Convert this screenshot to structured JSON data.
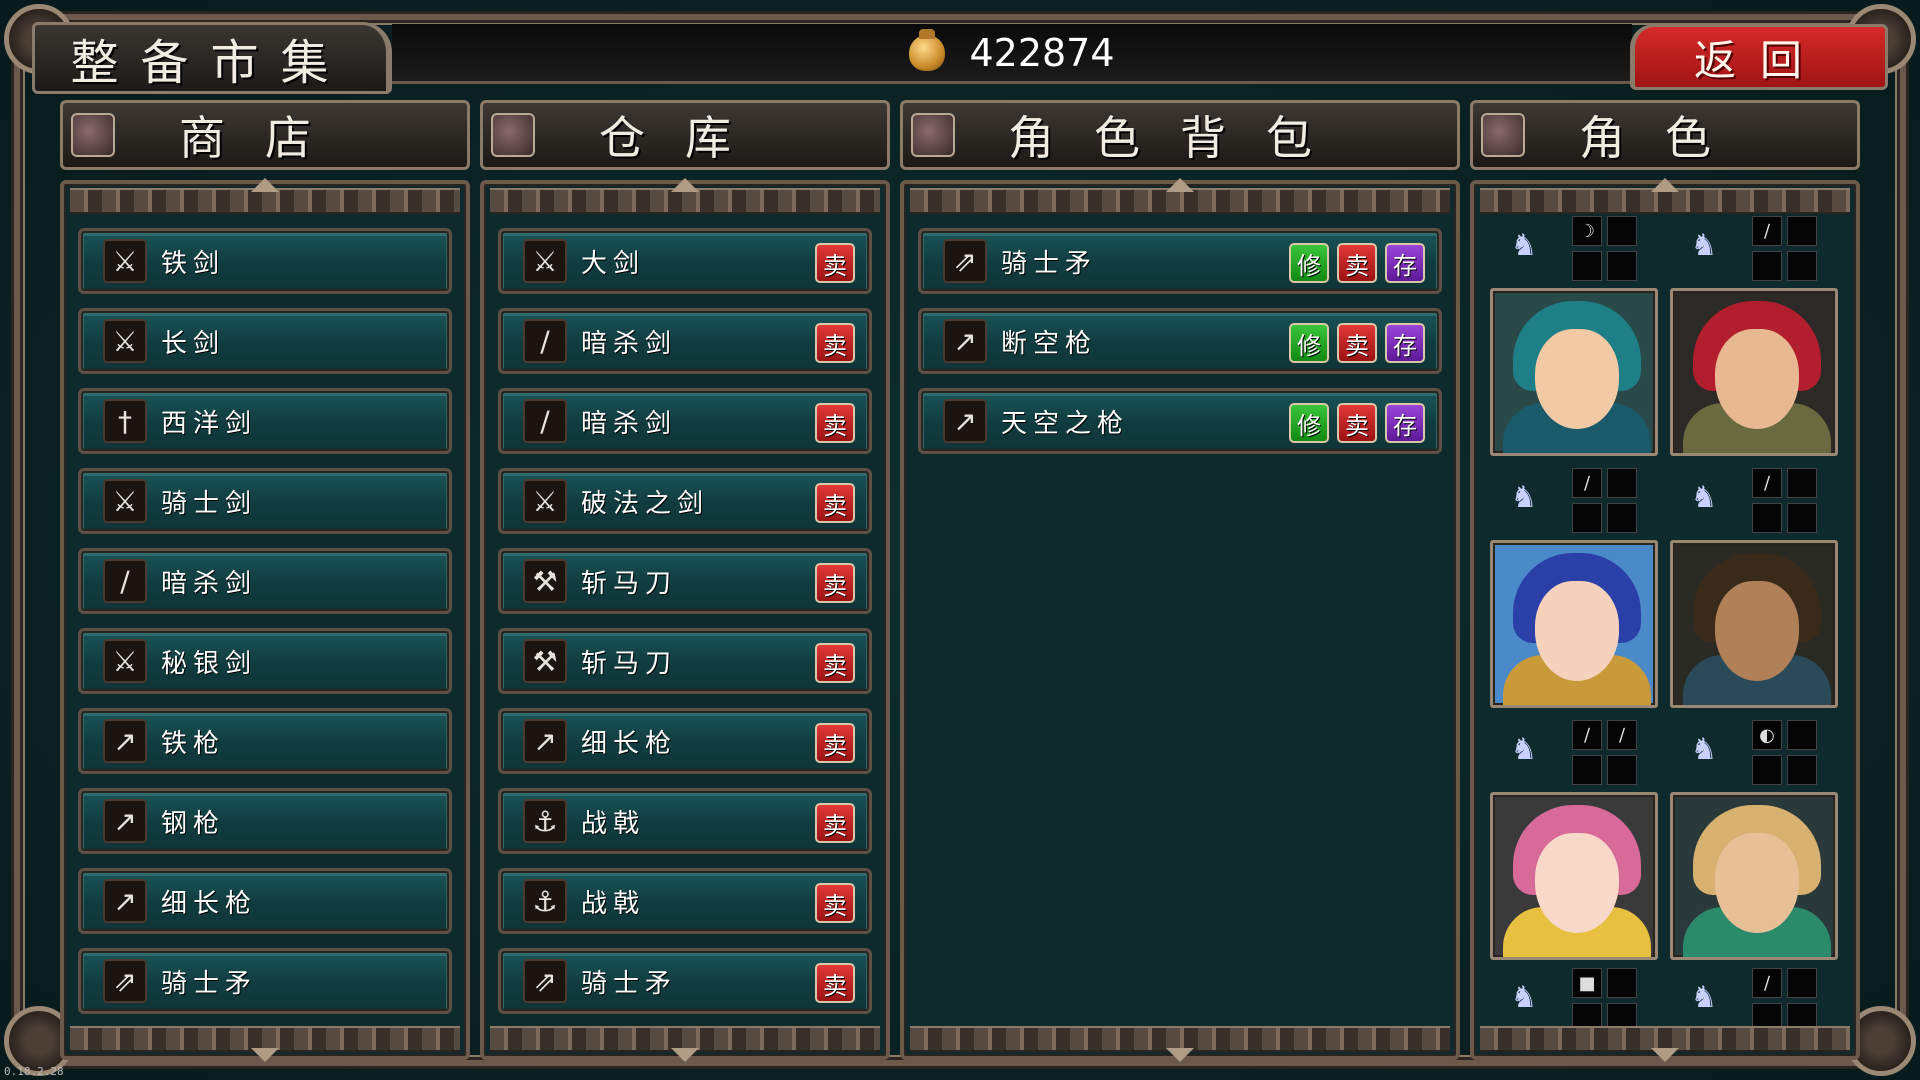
{
  "screen_title": "整备市集",
  "gold": "422874",
  "back_label": "返回",
  "columns": {
    "shop": "商店",
    "storage": "仓库",
    "backpack": "角色背包",
    "characters": "角色"
  },
  "buttons": {
    "sell": "卖",
    "repair": "修",
    "store": "存"
  },
  "shop_items": [
    {
      "name": "铁剑",
      "icon": "sword-icon"
    },
    {
      "name": "长剑",
      "icon": "sword-icon"
    },
    {
      "name": "西洋剑",
      "icon": "rapier-icon"
    },
    {
      "name": "骑士剑",
      "icon": "sword-icon"
    },
    {
      "name": "暗杀剑",
      "icon": "dagger-icon"
    },
    {
      "name": "秘银剑",
      "icon": "sword-icon"
    },
    {
      "name": "铁枪",
      "icon": "spear-icon"
    },
    {
      "name": "钢枪",
      "icon": "spear-icon"
    },
    {
      "name": "细长枪",
      "icon": "spear-icon"
    },
    {
      "name": "骑士矛",
      "icon": "lance-icon"
    }
  ],
  "storage_items": [
    {
      "name": "大剑",
      "icon": "greatsword-icon"
    },
    {
      "name": "暗杀剑",
      "icon": "dagger-icon"
    },
    {
      "name": "暗杀剑",
      "icon": "dagger-icon"
    },
    {
      "name": "破法之剑",
      "icon": "sword-icon"
    },
    {
      "name": "斩马刀",
      "icon": "blade-icon"
    },
    {
      "name": "斩马刀",
      "icon": "blade-icon"
    },
    {
      "name": "细长枪",
      "icon": "spear-icon"
    },
    {
      "name": "战戟",
      "icon": "halberd-icon"
    },
    {
      "name": "战戟",
      "icon": "halberd-icon"
    },
    {
      "name": "骑士矛",
      "icon": "lance-icon"
    }
  ],
  "backpack_items": [
    {
      "name": "骑士矛",
      "icon": "lance-icon"
    },
    {
      "name": "断空枪",
      "icon": "spear-icon"
    },
    {
      "name": "天空之枪",
      "icon": "spear-icon"
    }
  ],
  "characters": [
    {
      "name": "hooded-archer",
      "hair": "#1e7f86",
      "face": "#f1c9a4",
      "body": "#1a5a6a",
      "bg": "#2a4a4a",
      "slots": [
        "bow",
        "",
        "",
        ""
      ]
    },
    {
      "name": "red-haired-swordsman",
      "hair": "#b21e2e",
      "face": "#e8b892",
      "body": "#6a6a40",
      "bg": "#2c2a26",
      "slots": [
        "sword",
        "",
        "",
        ""
      ]
    },
    {
      "name": "blue-haired-pegasus-knight",
      "hair": "#2a3fa8",
      "face": "#f6d2bc",
      "body": "#c89a3a",
      "bg": "#4a8ac8",
      "slots": [
        "sword",
        "",
        "",
        ""
      ]
    },
    {
      "name": "pirate-captain",
      "hair": "#3a2a1a",
      "face": "#b08058",
      "body": "#2a4a5a",
      "bg": "#2a2a24",
      "slots": [
        "sword",
        "",
        "",
        ""
      ]
    },
    {
      "name": "pink-haired-cleric",
      "hair": "#d86a98",
      "face": "#f8d8c8",
      "body": "#e8c040",
      "bg": "#3a3a3a",
      "slots": [
        "sword",
        "sword",
        "",
        ""
      ]
    },
    {
      "name": "green-hat-ranger",
      "hair": "#d8b070",
      "face": "#e8c098",
      "body": "#2a8a6a",
      "bg": "#2a3a3a",
      "slots": [
        "shield",
        "",
        "",
        ""
      ]
    }
  ],
  "extra_slots": [
    {
      "slots": [
        "tome",
        "",
        "",
        ""
      ]
    },
    {
      "slots": [
        "sword",
        "",
        "",
        ""
      ]
    }
  ],
  "version": "0.18.2.28"
}
